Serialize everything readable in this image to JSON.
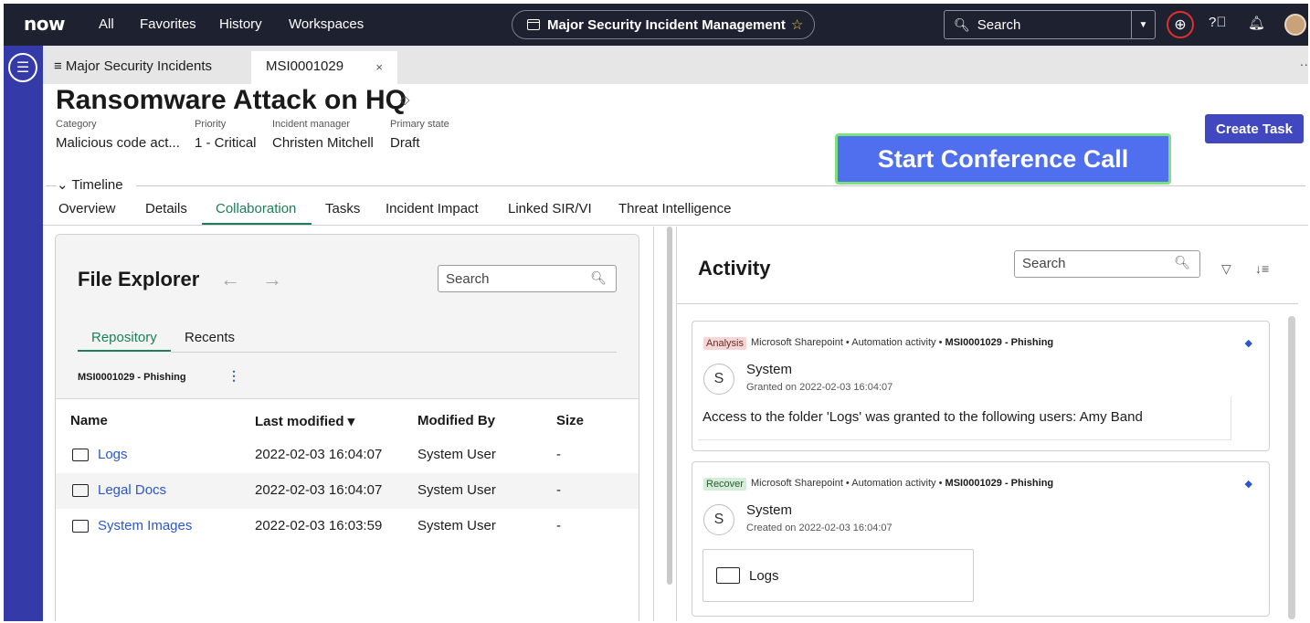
{
  "topbar": {
    "logo": "now",
    "nav": [
      "All",
      "Favorites",
      "History",
      "Workspaces"
    ],
    "app_title": "Major Security Incident Management",
    "search_placeholder": "Search"
  },
  "tabs": {
    "list_label": "≡ Major Security Incidents",
    "active_tab": "MSI0001029",
    "close": "×"
  },
  "record": {
    "title": "Ransomware Attack on HQ",
    "fields": [
      {
        "label": "Category",
        "value": "Malicious code act..."
      },
      {
        "label": "Priority",
        "value": "1 - Critical"
      },
      {
        "label": "Incident manager",
        "value": "Christen Mitchell"
      },
      {
        "label": "Primary state",
        "value": "Draft"
      }
    ],
    "timeline_label": "Timeline",
    "create_task": "Create Task",
    "conference_call": "Start Conference Call"
  },
  "nav_tabs": [
    "Overview",
    "Details",
    "Collaboration",
    "Tasks",
    "Incident Impact",
    "Linked SIR/VI",
    "Threat Intelligence"
  ],
  "file_explorer": {
    "title": "File Explorer",
    "search_placeholder": "Search",
    "subtabs": [
      "Repository",
      "Recents"
    ],
    "breadcrumb": "MSI0001029 - Phishing",
    "columns": [
      "Name",
      "Last modified ▾",
      "Modified By",
      "Size"
    ],
    "rows": [
      {
        "name": "Logs",
        "modified": "2022-02-03 16:04:07",
        "by": "System User",
        "size": "-"
      },
      {
        "name": "Legal Docs",
        "modified": "2022-02-03 16:04:07",
        "by": "System User",
        "size": "-"
      },
      {
        "name": "System Images",
        "modified": "2022-02-03 16:03:59",
        "by": "System User",
        "size": "-"
      }
    ]
  },
  "activity": {
    "title": "Activity",
    "search_placeholder": "Search",
    "cards": [
      {
        "badge": "Analysis",
        "source": "Microsoft Sharepoint • Automation activity •",
        "record": "MSI0001029 - Phishing",
        "avatar": "S",
        "user": "System",
        "sub": "Granted on 2022-02-03 16:04:07",
        "message": "Access to the folder 'Logs' was granted to the following users: Amy Band"
      },
      {
        "badge": "Recover",
        "source": "Microsoft Sharepoint • Automation activity •",
        "record": "MSI0001029 - Phishing",
        "avatar": "S",
        "user": "System",
        "sub": "Created on 2022-02-03 16:04:07",
        "file": "Logs"
      }
    ]
  },
  "colors": {
    "topbar": "#1e2130",
    "rail": "#343ba8",
    "primary_button": "#4147be",
    "accent_green": "#1b7f58",
    "conference_button": "#4f6fee",
    "link": "#2d57c8"
  }
}
